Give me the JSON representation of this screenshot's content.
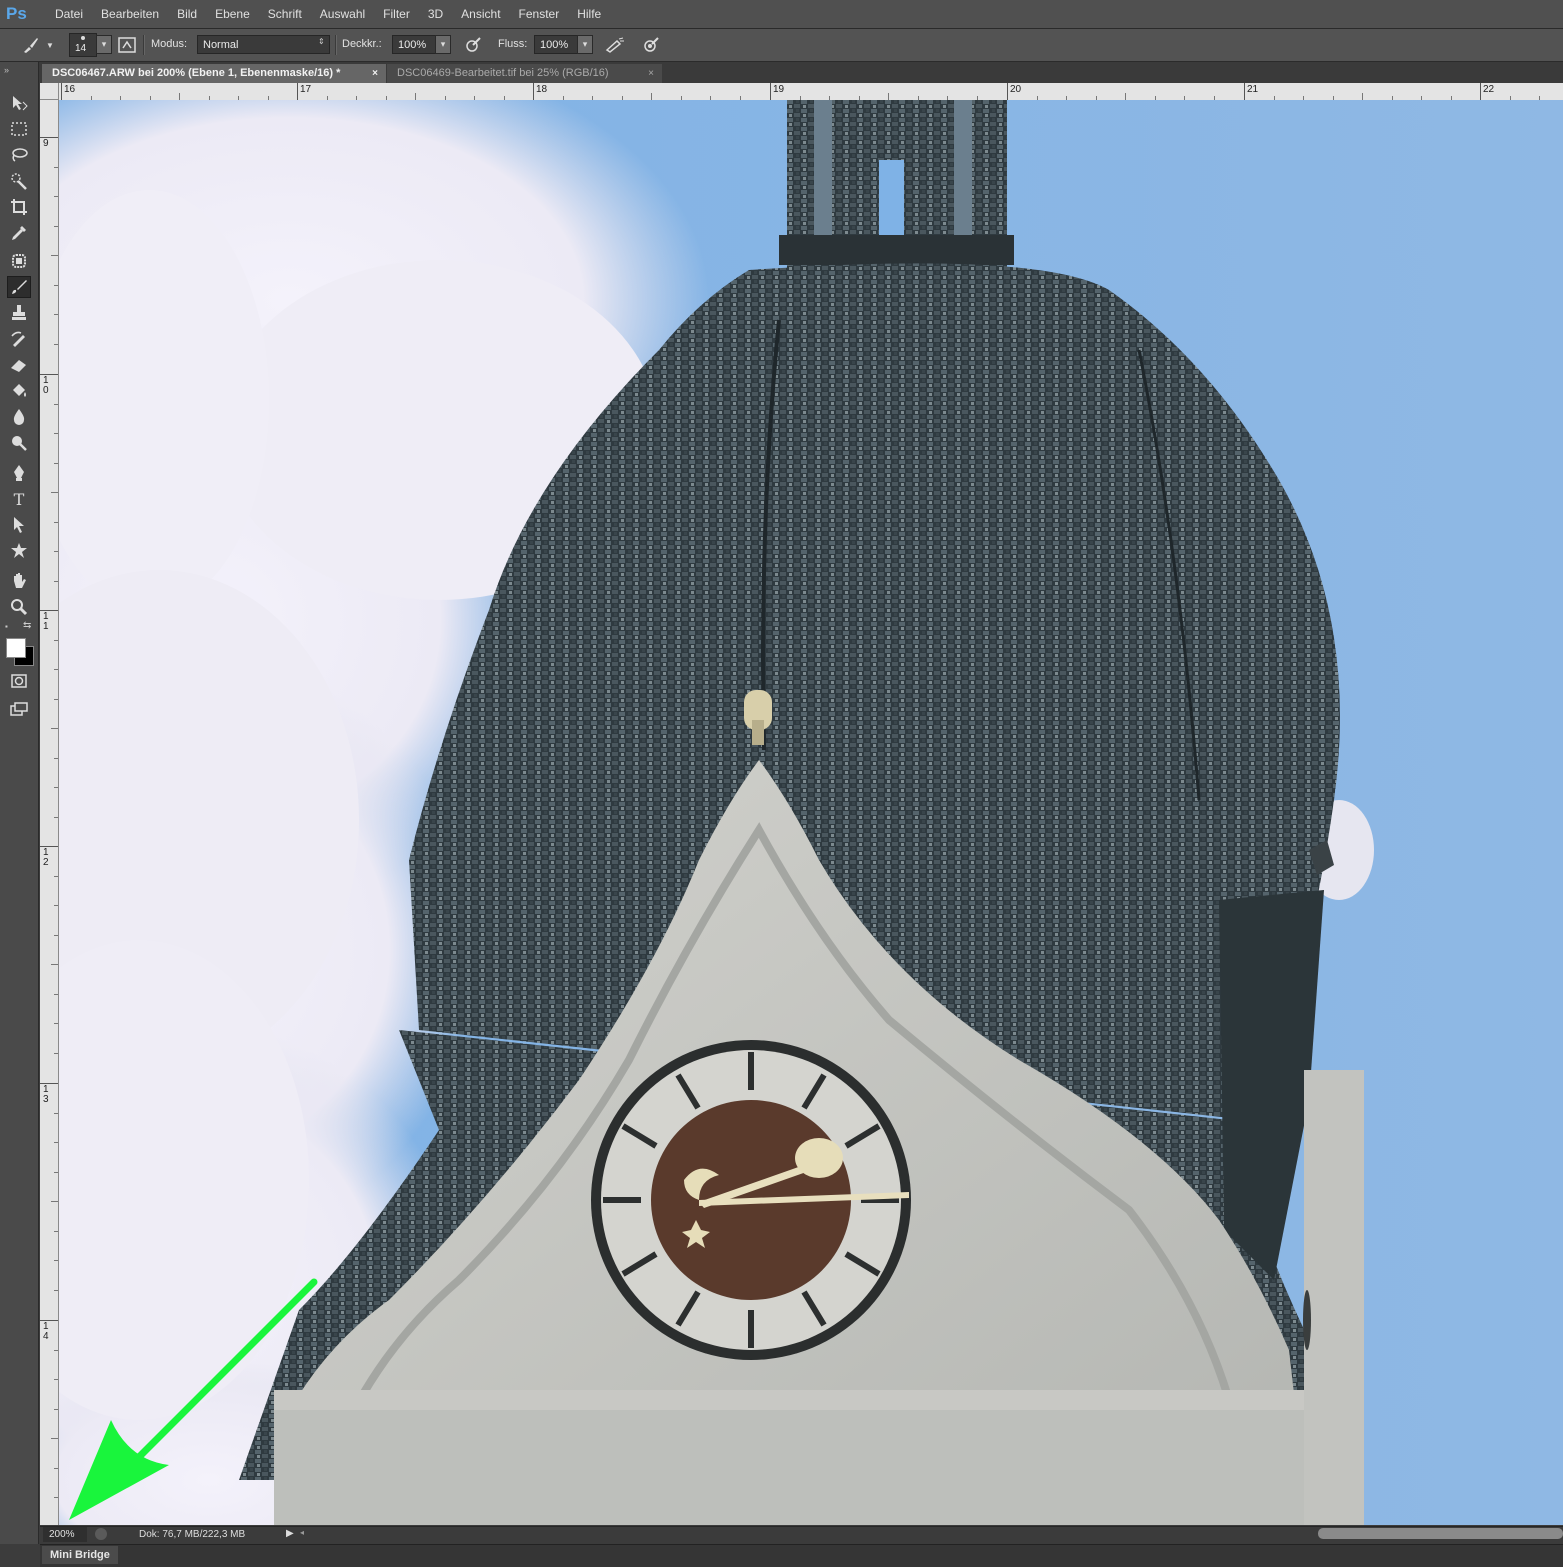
{
  "app": {
    "logo": "Ps"
  },
  "menu": [
    "Datei",
    "Bearbeiten",
    "Bild",
    "Ebene",
    "Schrift",
    "Auswahl",
    "Filter",
    "3D",
    "Ansicht",
    "Fenster",
    "Hilfe"
  ],
  "options": {
    "brush_size": "14",
    "mode_label": "Modus:",
    "mode_value": "Normal",
    "opacity_label": "Deckkr.:",
    "opacity_value": "100%",
    "flow_label": "Fluss:",
    "flow_value": "100%"
  },
  "tabs": [
    {
      "label": "DSC06467.ARW bei 200% (Ebene 1, Ebenenmaske/16) *",
      "active": true
    },
    {
      "label": "DSC06469-Bearbeitet.tif bei 25% (RGB/16)",
      "active": false
    }
  ],
  "tab_close": "×",
  "ruler_top_labels": [
    "16",
    "17",
    "18",
    "19",
    "20",
    "21",
    "22"
  ],
  "ruler_left_labels": [
    "9",
    "1\n0",
    "1\n1",
    "1\n2",
    "1\n3",
    "1\n4"
  ],
  "status": {
    "zoom": "200%",
    "doc_info": "Dok: 76,7 MB/222,3 MB"
  },
  "bottom_panel": {
    "label": "Mini Bridge"
  },
  "tools": [
    "move-tool",
    "rectangular-marquee-tool",
    "lasso-tool",
    "quick-selection-tool",
    "crop-tool",
    "eyedropper-tool",
    "spot-healing-tool",
    "brush-tool",
    "clone-stamp-tool",
    "history-brush-tool",
    "eraser-tool",
    "paint-bucket-tool",
    "blur-tool",
    "dodge-tool",
    "pen-tool",
    "type-tool",
    "path-selection-tool",
    "custom-shape-tool",
    "hand-tool",
    "zoom-tool"
  ],
  "colors": {
    "accent_arrow": "#19f53c",
    "foreground": "#ffffff",
    "background": "#000000"
  }
}
